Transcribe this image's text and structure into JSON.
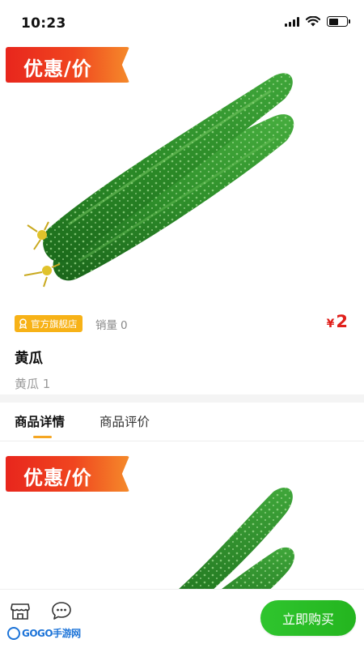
{
  "status_bar": {
    "time": "10:23"
  },
  "hero": {
    "promo_label": "优惠/价"
  },
  "product": {
    "badge": "官方旗舰店",
    "sales_label": "销量",
    "sales_count": "0",
    "currency": "¥",
    "price": "2",
    "title": "黄瓜",
    "subtitle": "黄瓜 1"
  },
  "tabs": [
    {
      "label": "商品详情",
      "active": true
    },
    {
      "label": "商品评价",
      "active": false
    }
  ],
  "detail": {
    "promo_label": "优惠/价"
  },
  "bottom_bar": {
    "buy_label": "立即购买",
    "watermark": "GOGO手游网"
  },
  "colors": {
    "accent": "#f5a623",
    "price": "#e0201b",
    "buy_button": "#2fc52e",
    "promo": "#e8261d"
  },
  "icons": {
    "status": [
      "signal-icon",
      "wifi-icon",
      "battery-icon"
    ],
    "badge": "award-icon",
    "bottom_bar": [
      "store-icon",
      "chat-icon"
    ]
  }
}
